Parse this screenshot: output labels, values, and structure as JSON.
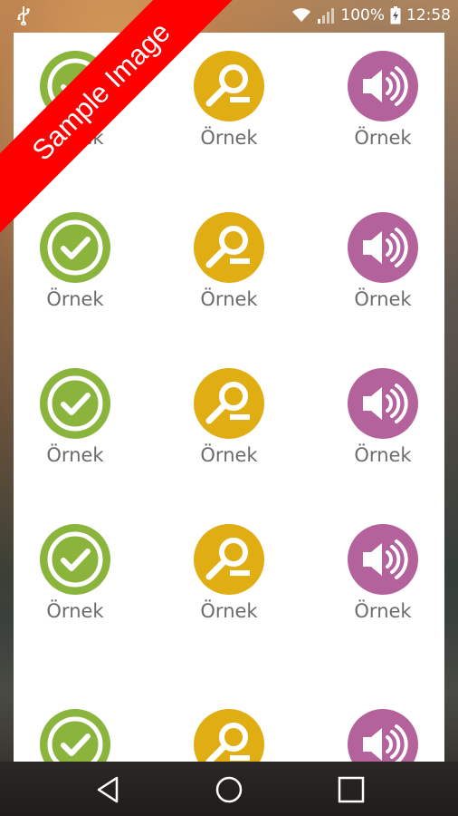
{
  "status_bar": {
    "battery": "100%",
    "time": "12:58",
    "icons": [
      "usb-icon",
      "wifi-icon",
      "signal-icon",
      "battery-charging-icon"
    ]
  },
  "watermark": {
    "text": "Sample Image",
    "color": "#ff0000"
  },
  "grid": {
    "rows": [
      [
        {
          "icon": "check-circle-icon",
          "color": "#8ab43c",
          "label": "Örnek"
        },
        {
          "icon": "search-zoom-out-icon",
          "color": "#e0ae12",
          "label": "Örnek"
        },
        {
          "icon": "speaker-volume-icon",
          "color": "#b4629c",
          "label": "Örnek"
        }
      ],
      [
        {
          "icon": "check-circle-icon",
          "color": "#8ab43c",
          "label": "Örnek"
        },
        {
          "icon": "search-zoom-out-icon",
          "color": "#e0ae12",
          "label": "Örnek"
        },
        {
          "icon": "speaker-volume-icon",
          "color": "#b4629c",
          "label": "Örnek"
        }
      ],
      [
        {
          "icon": "check-circle-icon",
          "color": "#8ab43c",
          "label": "Örnek"
        },
        {
          "icon": "search-zoom-out-icon",
          "color": "#e0ae12",
          "label": "Örnek"
        },
        {
          "icon": "speaker-volume-icon",
          "color": "#b4629c",
          "label": "Örnek"
        }
      ],
      [
        {
          "icon": "check-circle-icon",
          "color": "#8ab43c",
          "label": "Örnek"
        },
        {
          "icon": "search-zoom-out-icon",
          "color": "#e0ae12",
          "label": "Örnek"
        },
        {
          "icon": "speaker-volume-icon",
          "color": "#b4629c",
          "label": "Örnek"
        }
      ],
      [
        {
          "icon": "check-circle-icon",
          "color": "#8ab43c",
          "label": ""
        },
        {
          "icon": "search-zoom-out-icon",
          "color": "#e0ae12",
          "label": ""
        },
        {
          "icon": "speaker-volume-icon",
          "color": "#b4629c",
          "label": ""
        }
      ]
    ]
  },
  "nav_bar": {
    "icons": [
      "back-icon",
      "home-icon",
      "recent-apps-icon"
    ]
  }
}
